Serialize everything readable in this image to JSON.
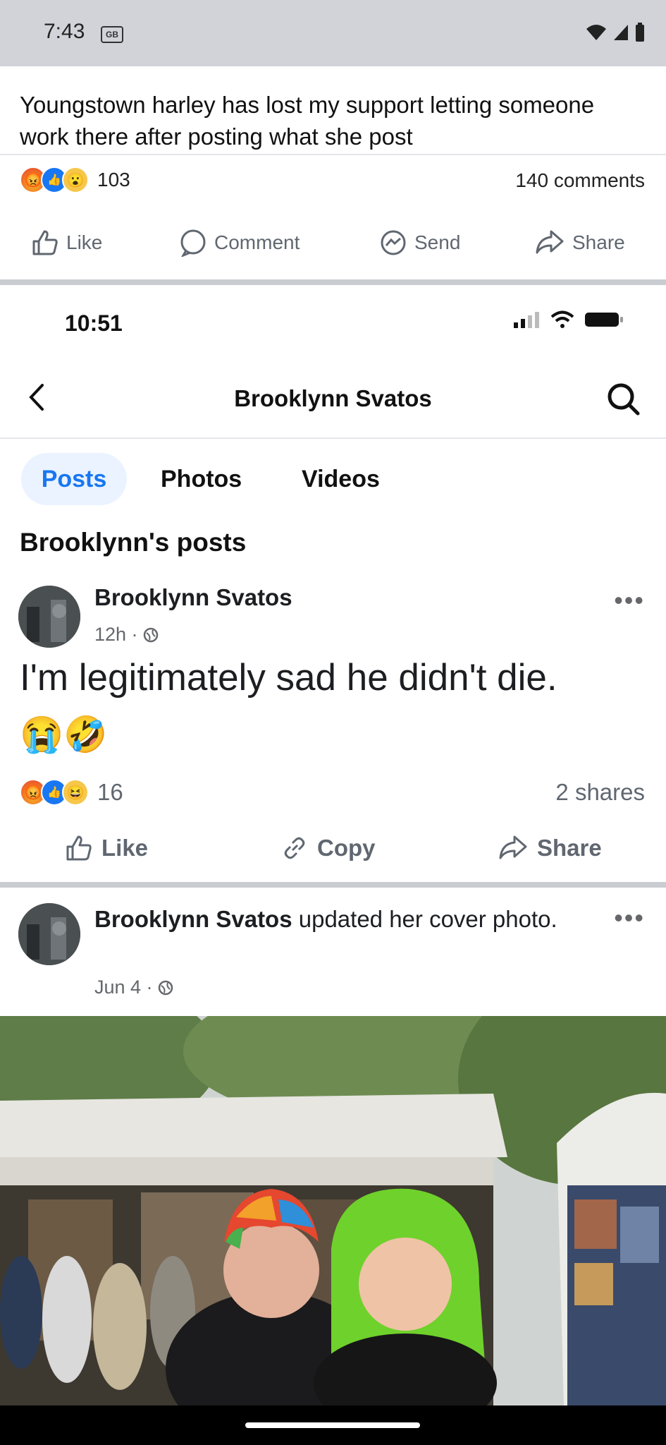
{
  "status_bar": {
    "time": "7:43",
    "badge": "GB"
  },
  "outer_post": {
    "text": "Youngstown harley has lost my support letting someone work there after posting what she post",
    "reaction_count": "103",
    "comments": "140 comments",
    "actions": {
      "like": "Like",
      "comment": "Comment",
      "send": "Send",
      "share": "Share"
    }
  },
  "inner_screenshot": {
    "time": "10:51",
    "header": {
      "title": "Brooklynn Svatos"
    },
    "tabs": [
      {
        "label": "Posts",
        "active": true
      },
      {
        "label": "Photos"
      },
      {
        "label": "Videos"
      }
    ],
    "section_heading": "Brooklynn's posts",
    "post1": {
      "author": "Brooklynn Svatos",
      "meta": "12h ·",
      "text": "I'm legitimately sad he didn't die.",
      "emoji": "😭🤣",
      "reaction_count": "16",
      "shares": "2 shares",
      "actions": {
        "like": "Like",
        "copy": "Copy",
        "share": "Share"
      }
    },
    "post2": {
      "author": "Brooklynn Svatos",
      "text": " updated her cover photo.",
      "meta": "Jun 4 ·"
    }
  },
  "colors": {
    "facebook_blue": "#1877f2",
    "text_secondary": "#65676b"
  }
}
